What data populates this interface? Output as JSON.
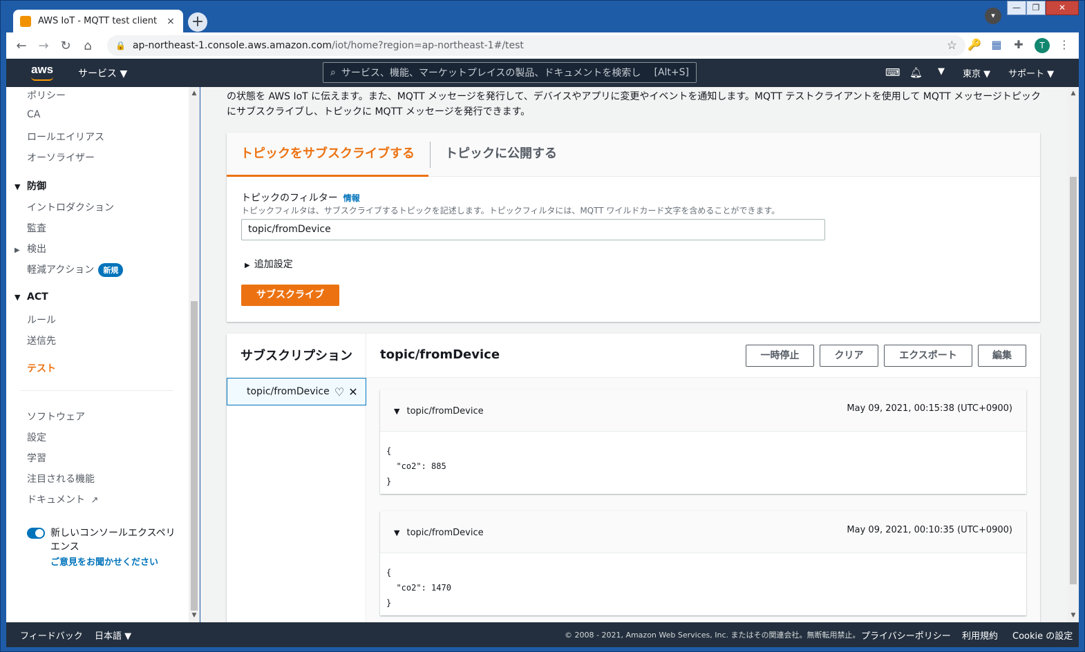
{
  "browser": {
    "tab_title": "AWS IoT - MQTT test client",
    "tab_close": "×",
    "new_tab": "+",
    "url_host": "ap-northeast-1.console.aws.amazon.com",
    "url_path": "/iot/home?region=ap-northeast-1#/test",
    "profile_initial": "T",
    "window_min": "—",
    "window_max": "❐",
    "window_close": "✕"
  },
  "aws_nav": {
    "logo": "aws",
    "services": "サービス ▼",
    "search_placeholder": "サービス、機能、マーケットプレイスの製品、ドキュメントを検索し",
    "search_shortcut": "[Alt+S]",
    "region": "東京 ▼",
    "support": "サポート ▼"
  },
  "sidebar": {
    "items_top": [
      "ポリシー",
      "CA",
      "ロールエイリアス",
      "オーソライザー"
    ],
    "defense_head": "防御",
    "defense_items": [
      "イントロダクション",
      "監査",
      "検出",
      "軽減アクション"
    ],
    "new_badge": "新規",
    "act_head": "ACT",
    "act_items": [
      "ルール",
      "送信先"
    ],
    "active_item": "テスト",
    "bottom_items": [
      "ソフトウェア",
      "設定",
      "学習",
      "注目される機能",
      "ドキュメント"
    ],
    "toggle_label": "新しいコンソールエクスペリエンス",
    "feedback_link": "ご意見をお聞かせください"
  },
  "main": {
    "intro": "の状態を AWS IoT に伝えます。また、MQTT メッセージを発行して、デバイスやアプリに変更やイベントを通知します。MQTT テストクライアントを使用して MQTT メッセージトピックにサブスクライブし、トピックに MQTT メッセージを発行できます。",
    "tab_subscribe": "トピックをサブスクライブする",
    "tab_publish": "トピックに公開する",
    "filter_label": "トピックのフィルター",
    "filter_info": "情報",
    "filter_desc": "トピックフィルタは、サブスクライブするトピックを記述します。トピックフィルタには、MQTT ワイルドカード文字を含めることができます。",
    "filter_value": "topic/fromDevice",
    "advanced": "追加設定",
    "subscribe_button": "サブスクライブ"
  },
  "subscriptions": {
    "title": "サブスクリプション",
    "items": [
      {
        "topic": "topic/fromDevice"
      }
    ],
    "selected_topic": "topic/fromDevice",
    "buttons": {
      "pause": "一時停止",
      "clear": "クリア",
      "export": "エクスポート",
      "edit": "編集"
    },
    "messages": [
      {
        "topic": "topic/fromDevice",
        "time": "May 09, 2021, 00:15:38 (UTC+0900)",
        "body": "{\n  \"co2\": 885\n}"
      },
      {
        "topic": "topic/fromDevice",
        "time": "May 09, 2021, 00:10:35 (UTC+0900)",
        "body": "{\n  \"co2\": 1470\n}"
      }
    ]
  },
  "footer": {
    "feedback": "フィードバック",
    "language": "日本語 ▼",
    "copyright": "© 2008 - 2021, Amazon Web Services, Inc. またはその関連会社。無断転用禁止。",
    "privacy": "プライバシーポリシー",
    "terms": "利用規約",
    "cookie": "Cookie の設定"
  },
  "colors": {
    "accent": "#ec7211",
    "link": "#0073bb",
    "nav_bg": "#232f3e"
  }
}
